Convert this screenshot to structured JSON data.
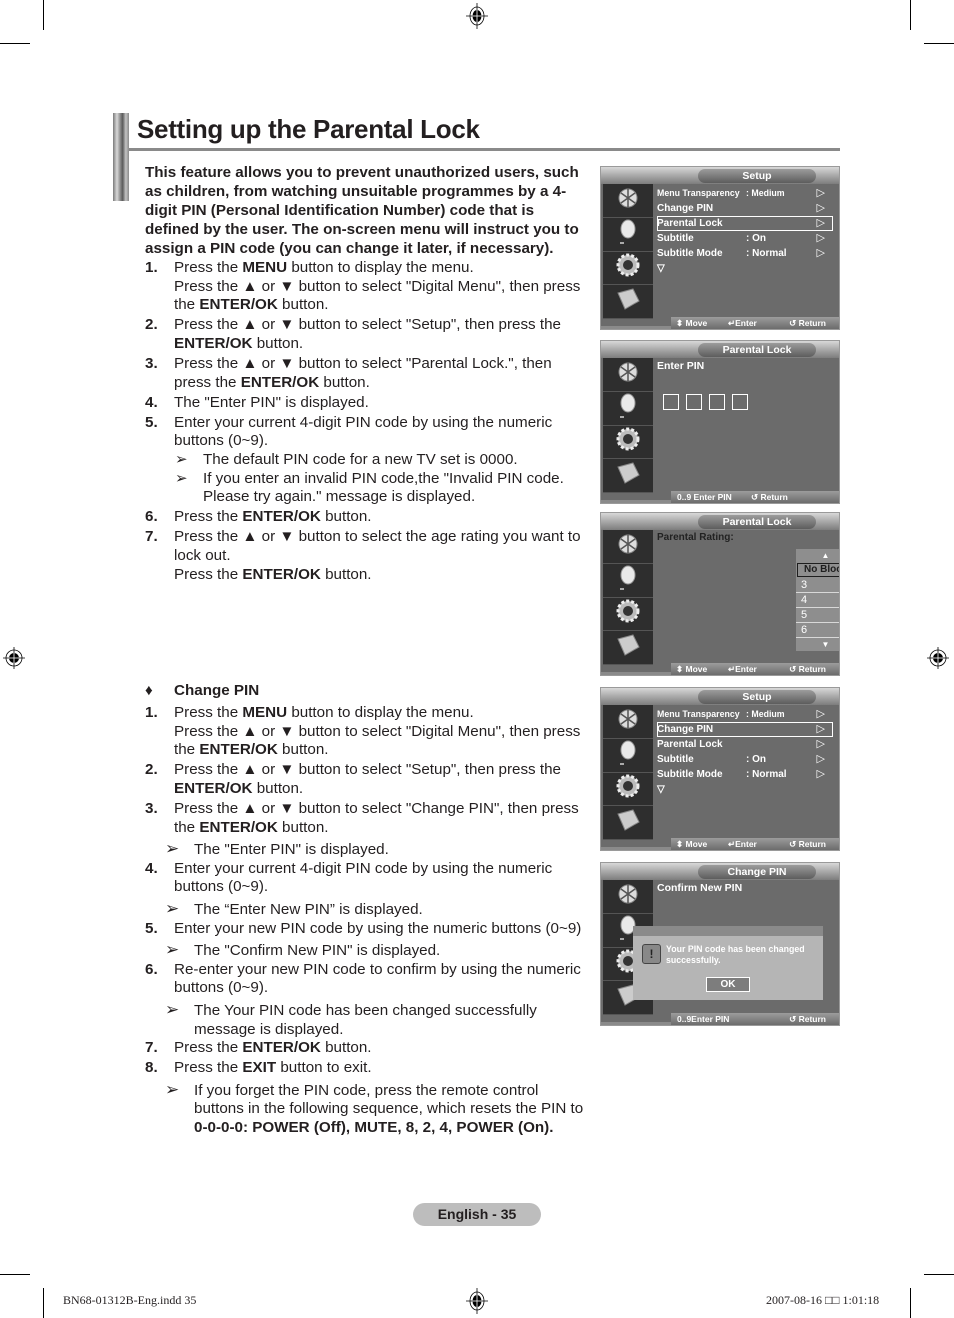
{
  "page": {
    "title": "Setting up the Parental Lock",
    "intro": "This feature allows you to prevent unauthorized users, such as children, from watching unsuitable programmes by a 4-digit PIN (Personal Identification Number) code that is defined by the user.  The on-screen menu will instruct you to assign a PIN code (you can change it later, if necessary).",
    "page_label": "English - 35",
    "slug_left": "BN68-01312B-Eng.indd   35",
    "slug_right": "2007-08-16   □□ 1:01:18"
  },
  "parental_lock_steps": [
    {
      "num": "1.",
      "parts": [
        [
          "Press the ",
          ""
        ],
        [
          "MENU",
          "b"
        ],
        [
          " button to display the menu.",
          ""
        ]
      ],
      "line2": [
        [
          "Press the ▲ or ▼ button to select \"Digital Menu\", then press the ",
          ""
        ],
        [
          "ENTER/OK",
          "b"
        ],
        [
          " button.",
          ""
        ]
      ]
    },
    {
      "num": "2.",
      "parts": [
        [
          "Press the ▲ or ▼ button to select \"Setup\", then press the ",
          ""
        ],
        [
          "ENTER/OK",
          "b"
        ],
        [
          " button.",
          ""
        ]
      ]
    },
    {
      "num": "3.",
      "parts": [
        [
          "Press the ▲ or ▼ button to select \"Parental Lock.\", then press the ",
          ""
        ],
        [
          "ENTER/OK",
          "b"
        ],
        [
          " button.",
          ""
        ]
      ]
    },
    {
      "num": "4.",
      "parts": [
        [
          "The \"Enter PIN\" is displayed.",
          ""
        ]
      ]
    },
    {
      "num": "5.",
      "parts": [
        [
          "Enter your current 4-digit PIN code by using the numeric buttons (0~9).",
          ""
        ]
      ],
      "notes": [
        "The default PIN code for a new TV set is 0000.",
        "If you enter an invalid PIN code,the \"Invalid PIN code. Please try again.\" message is displayed."
      ]
    },
    {
      "num": "6.",
      "parts": [
        [
          "Press the ",
          ""
        ],
        [
          "ENTER/OK",
          "b"
        ],
        [
          " button.",
          ""
        ]
      ]
    },
    {
      "num": "7.",
      "parts": [
        [
          "Press the ▲ or ▼ button to select the age rating you want to lock out.",
          ""
        ]
      ],
      "line2": [
        [
          "Press the ",
          ""
        ],
        [
          "ENTER/OK",
          "b"
        ],
        [
          " button.",
          ""
        ]
      ]
    }
  ],
  "change_pin": {
    "bullet": "♦",
    "heading": "Change PIN",
    "steps": [
      {
        "num": "1.",
        "parts": [
          [
            "Press the ",
            ""
          ],
          [
            "MENU",
            "b"
          ],
          [
            " button to display the menu.",
            ""
          ]
        ],
        "line2": [
          [
            "Press the ▲ or ▼ button to select \"Digital Menu\", then press the ",
            ""
          ],
          [
            "ENTER/OK",
            "b"
          ],
          [
            " button.",
            ""
          ]
        ]
      },
      {
        "num": "2.",
        "parts": [
          [
            "Press the ▲ or ▼ button to select \"Setup\", then press the ",
            ""
          ],
          [
            "ENTER/OK",
            "b"
          ],
          [
            " button.",
            ""
          ]
        ]
      },
      {
        "num": "3.",
        "parts": [
          [
            "Press the ▲ or ▼ button to select \"Change PIN\", then press the ",
            ""
          ],
          [
            "ENTER/OK",
            "b"
          ],
          [
            " button.",
            ""
          ]
        ],
        "notes_after": [
          "The \"Enter PIN\" is displayed."
        ]
      },
      {
        "num": "4.",
        "parts": [
          [
            "Enter your current 4-digit PIN code by using the numeric buttons (0~9).",
            ""
          ]
        ],
        "notes_after": [
          "The “Enter New PIN” is displayed."
        ]
      },
      {
        "num": "5.",
        "parts": [
          [
            "Enter your new PIN code by using the numeric buttons (0~9)",
            ""
          ]
        ],
        "notes_after": [
          "The \"Confirm New PIN\" is displayed."
        ]
      },
      {
        "num": "6.",
        "parts": [
          [
            "Re-enter your new PIN code to confirm by using the numeric buttons (0~9).",
            ""
          ]
        ],
        "notes_after": [
          "The Your PIN code has been changed successfully message is displayed."
        ]
      },
      {
        "num": "7.",
        "parts": [
          [
            "Press the ",
            ""
          ],
          [
            "ENTER/OK",
            "b"
          ],
          [
            " button.",
            ""
          ]
        ]
      },
      {
        "num": "8.",
        "parts": [
          [
            "Press the ",
            ""
          ],
          [
            "EXIT",
            "b"
          ],
          [
            " button to exit.",
            ""
          ]
        ]
      }
    ],
    "final_note": [
      [
        "If you forget the PIN code, press the remote control buttons in the following sequence, which resets the PIN to ",
        ""
      ],
      [
        "0-0-0-0: POWER (Off), MUTE, 8, 2, 4, POWER (On).",
        "b"
      ]
    ]
  },
  "osd_screens": [
    {
      "id": "setup-parental",
      "header": "Setup",
      "rows": [
        {
          "label": "Menu Transparency",
          "value": ": Medium",
          "arrow": "▷",
          "small": true
        },
        {
          "label": "Change PIN",
          "value": "",
          "arrow": "▷"
        },
        {
          "label": "Parental Lock",
          "value": "",
          "arrow": "▷",
          "selected": true
        },
        {
          "label": "Subtitle",
          "value": ": On",
          "arrow": "▷"
        },
        {
          "label": "Subtitle  Mode",
          "value": ": Normal",
          "arrow": "▷"
        },
        {
          "label": "▽",
          "value": "",
          "arrow": ""
        }
      ],
      "footer": {
        "move": "⬍ Move",
        "enter": "↵Enter",
        "ret": "↺ Return"
      }
    },
    {
      "id": "parental-enter-pin",
      "header": "Parental Lock",
      "prompt": "Enter PIN",
      "pin_boxes": 4,
      "footer": {
        "enter": "0..9 Enter PIN",
        "ret": "↺ Return"
      }
    },
    {
      "id": "parental-rating",
      "header": "Parental Lock",
      "label": "Parental Rating:",
      "options": [
        "No Block",
        "3",
        "4",
        "5",
        "6"
      ],
      "selected": "No Block",
      "footer": {
        "move": "⬍ Move",
        "enter": "↵Enter",
        "ret": "↺ Return"
      }
    },
    {
      "id": "setup-change-pin",
      "header": "Setup",
      "rows": [
        {
          "label": "Menu Transparency",
          "value": ": Medium",
          "arrow": "▷",
          "small": true
        },
        {
          "label": "Change PIN",
          "value": "",
          "arrow": "▷",
          "selected": true
        },
        {
          "label": "Parental Lock",
          "value": "",
          "arrow": "▷"
        },
        {
          "label": "Subtitle",
          "value": ": On",
          "arrow": "▷"
        },
        {
          "label": "Subtitle  Mode",
          "value": ": Normal",
          "arrow": "▷"
        },
        {
          "label": "▽",
          "value": "",
          "arrow": ""
        }
      ],
      "footer": {
        "move": "⬍ Move",
        "enter": "↵Enter",
        "ret": "↺ Return"
      }
    },
    {
      "id": "change-pin-confirm",
      "header": "Change PIN",
      "prompt": "Confirm New PIN",
      "dialog": {
        "icon": "!",
        "message": "Your PIN code has been changed successfully.",
        "ok": "OK"
      },
      "footer": {
        "enter": "0..9Enter PIN",
        "ret": "↺ Return"
      }
    }
  ],
  "sidebar_icons": [
    "antenna-icon",
    "satellite-dish-icon",
    "gear-icon",
    "input-plug-icon"
  ]
}
